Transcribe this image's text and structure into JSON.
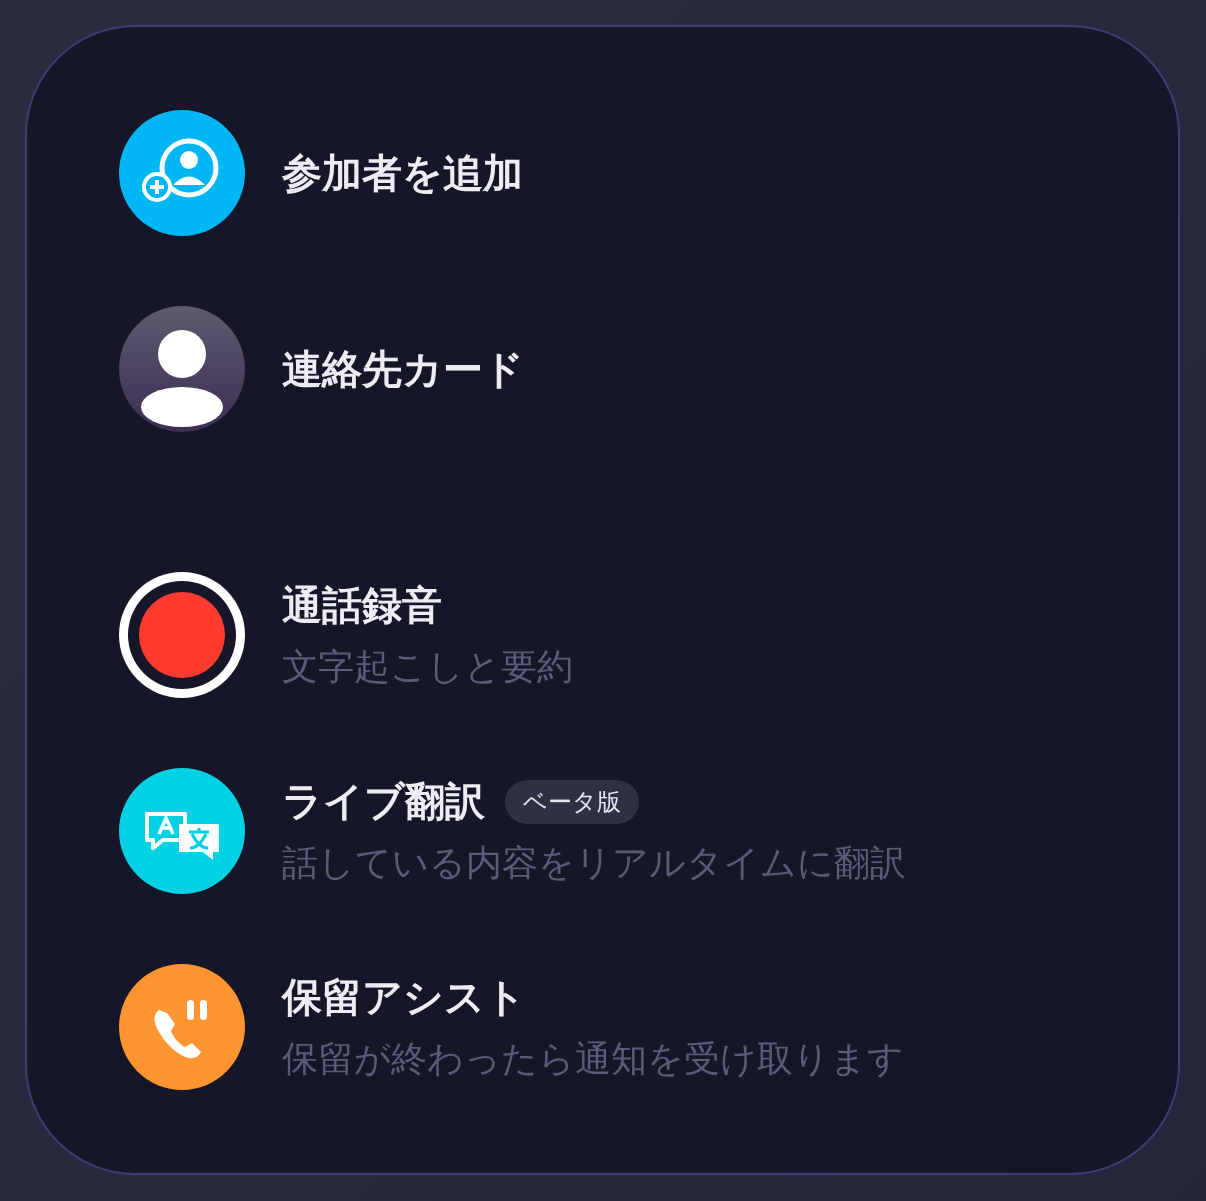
{
  "sections": [
    {
      "items": [
        {
          "kind": "add",
          "title": "参加者を追加"
        },
        {
          "kind": "contact",
          "title": "連絡先カード"
        }
      ]
    },
    {
      "items": [
        {
          "kind": "record",
          "title": "通話録音",
          "subtitle": "文字起こしと要約"
        },
        {
          "kind": "translate",
          "title": "ライブ翻訳",
          "badge": "ベータ版",
          "subtitle": "話している内容をリアルタイムに翻訳"
        },
        {
          "kind": "hold",
          "title": "保留アシスト",
          "subtitle": "保留が終わったら通知を受け取ります"
        }
      ]
    }
  ]
}
